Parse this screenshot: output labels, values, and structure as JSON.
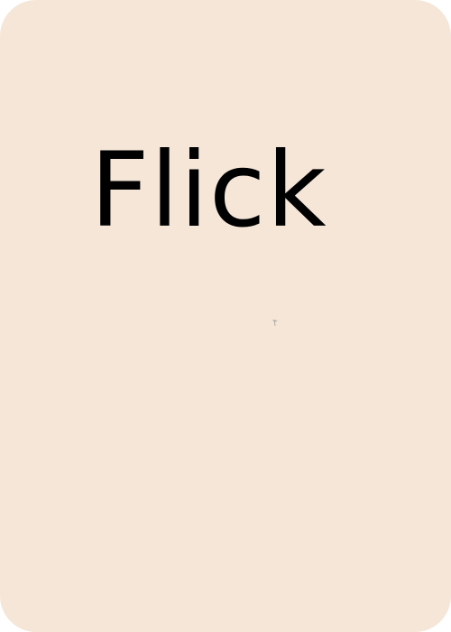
{
  "card": {
    "title": "Flick",
    "background_color": "#f5e6d8",
    "text_color": "#000000"
  },
  "cursor": {
    "icon": "mouse-pointer-icon"
  }
}
